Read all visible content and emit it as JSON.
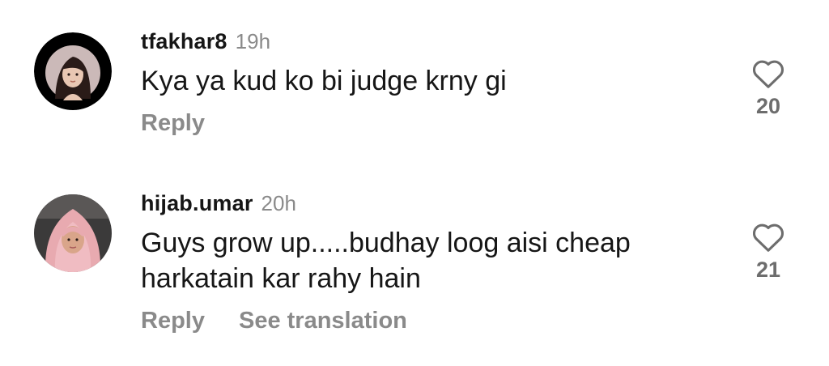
{
  "comments": [
    {
      "username": "tfakhar8",
      "time": "19h",
      "text": "Kya ya kud ko bi judge krny gi",
      "actions": [
        "Reply"
      ],
      "likes": "20",
      "avatar": "illustrated-girl-avatar"
    },
    {
      "username": "hijab.umar",
      "time": "20h",
      "text": "Guys grow up.....budhay loog aisi cheap harkatain kar rahy hain",
      "actions": [
        "Reply",
        "See translation"
      ],
      "likes": "21",
      "avatar": "woman-in-pink-hijab-avatar"
    }
  ],
  "icons": {
    "like": "heart-outline-icon"
  },
  "colors": {
    "secondary_text": "#8a8a8a",
    "primary_text": "#161616"
  }
}
